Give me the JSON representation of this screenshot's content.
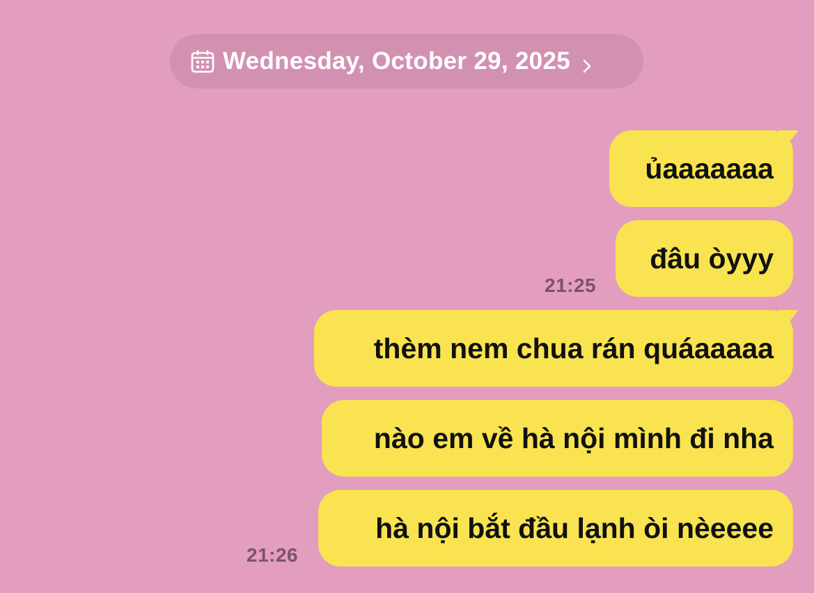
{
  "colors": {
    "background": "#e39dbf",
    "date_pill": "#d391b1",
    "bubble": "#f9e350",
    "timestamp": "#7a5468"
  },
  "date_header": {
    "icon": "calendar-icon",
    "text": "Wednesday, October 29, 2025",
    "chevron_icon": "chevron-right-icon"
  },
  "messages": [
    {
      "text": "ủaaaaaaa"
    },
    {
      "text": "đâu òyyy"
    },
    {
      "text": "thèm nem chua rán quáaaaaa"
    },
    {
      "text": "nào em về hà nội mình đi nha"
    },
    {
      "text": "hà nội bắt đầu lạnh òi nèeeee"
    }
  ],
  "timestamps": [
    "21:25",
    "21:26"
  ]
}
